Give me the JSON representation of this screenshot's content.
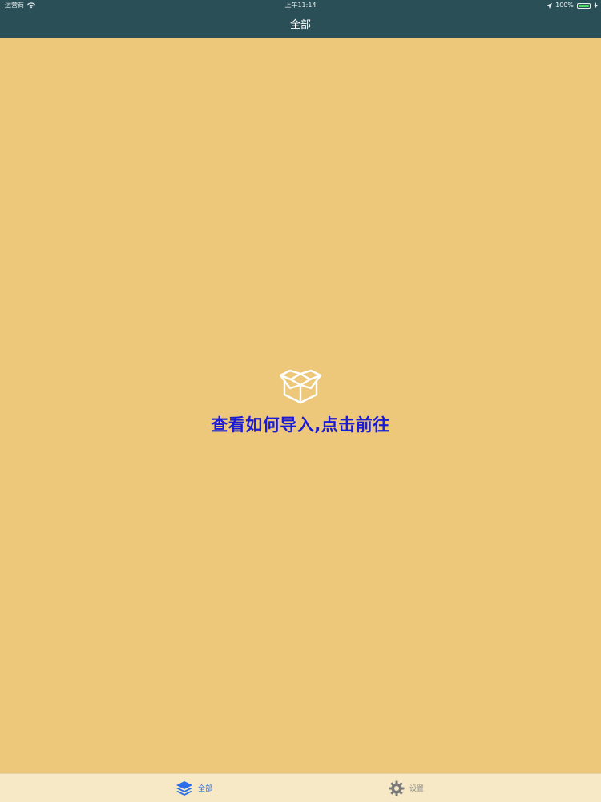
{
  "status_bar": {
    "carrier": "运营商",
    "time": "上午11:14",
    "battery_text": "100%",
    "battery_level": 1.0
  },
  "nav": {
    "title": "全部"
  },
  "empty_state": {
    "icon": "open-box-icon",
    "link_text": "查看如何导入,点击前往"
  },
  "tab_bar": {
    "tabs": [
      {
        "label": "全部",
        "icon": "layers-icon",
        "selected": true
      },
      {
        "label": "设置",
        "icon": "gear-icon",
        "selected": false
      }
    ]
  },
  "colors": {
    "background": "#edc87a",
    "header": "#2b4f57",
    "link": "#1a1bd6",
    "tab_bar": "#f7e9c6",
    "tab_selected": "#2b6de8",
    "tab_unselected": "#8a8a8a"
  }
}
